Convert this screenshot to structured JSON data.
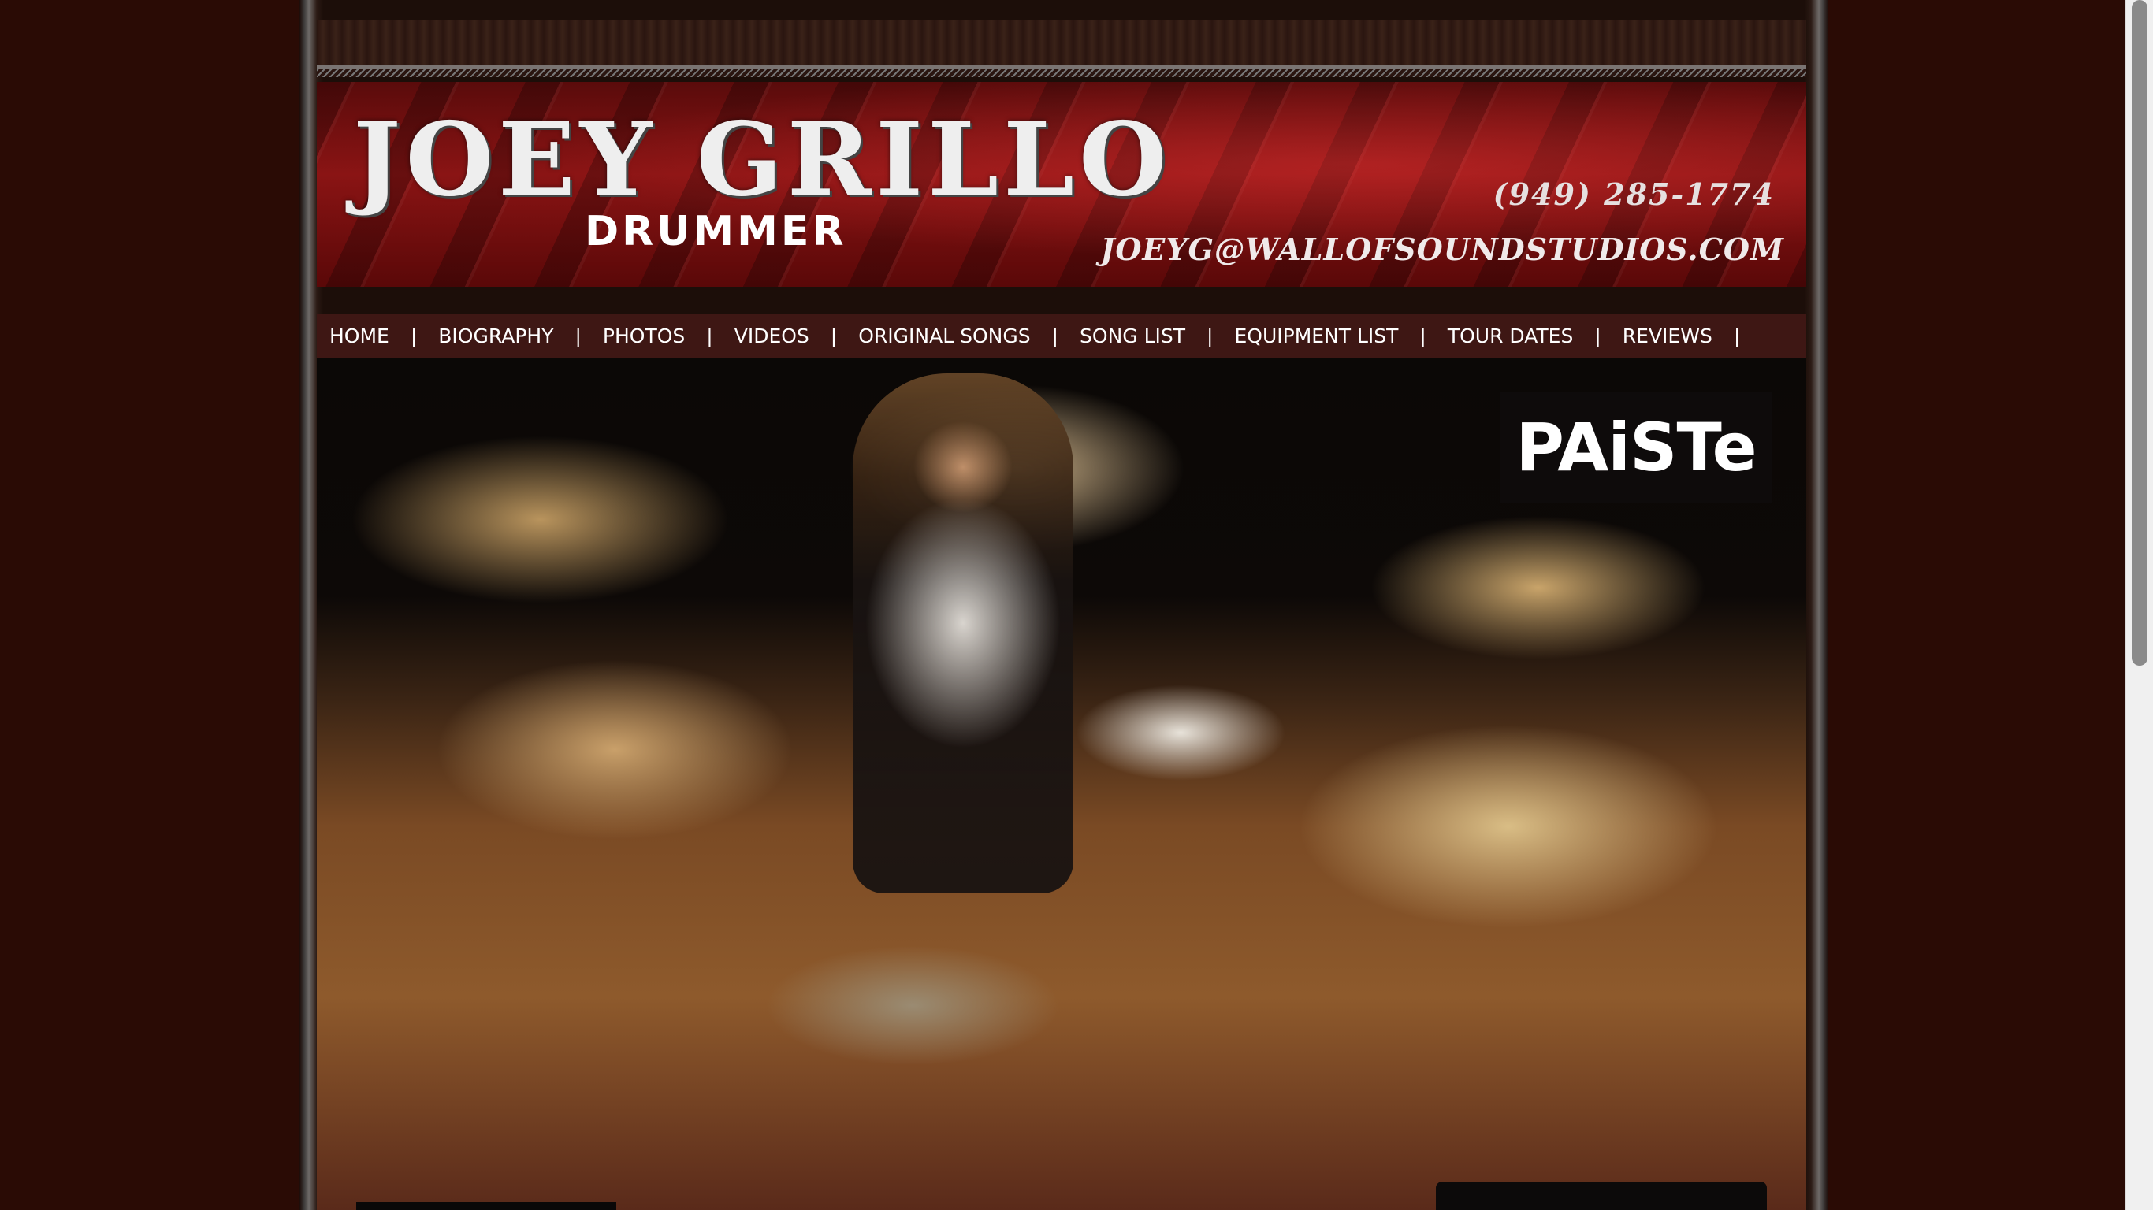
{
  "banner": {
    "name": "JOEY GRILLO",
    "subtitle": "DRUMMER",
    "phone": "(949) 285-1774",
    "email": "JOEYG@WALLOFSOUNDSTUDIOS.COM"
  },
  "nav": {
    "separator": "|",
    "items": [
      {
        "label": "HOME"
      },
      {
        "label": "BIOGRAPHY"
      },
      {
        "label": "PHOTOS"
      },
      {
        "label": "VIDEOS"
      },
      {
        "label": "ORIGINAL SONGS"
      },
      {
        "label": "SONG LIST"
      },
      {
        "label": "EQUIPMENT LIST"
      },
      {
        "label": "TOUR DATES"
      },
      {
        "label": "REVIEWS"
      }
    ]
  },
  "hero": {
    "logo_text": "PAiSTe"
  },
  "colors": {
    "background": "#2a0b05",
    "nav_bar": "#3e1714",
    "banner_red": "#8a1414"
  }
}
